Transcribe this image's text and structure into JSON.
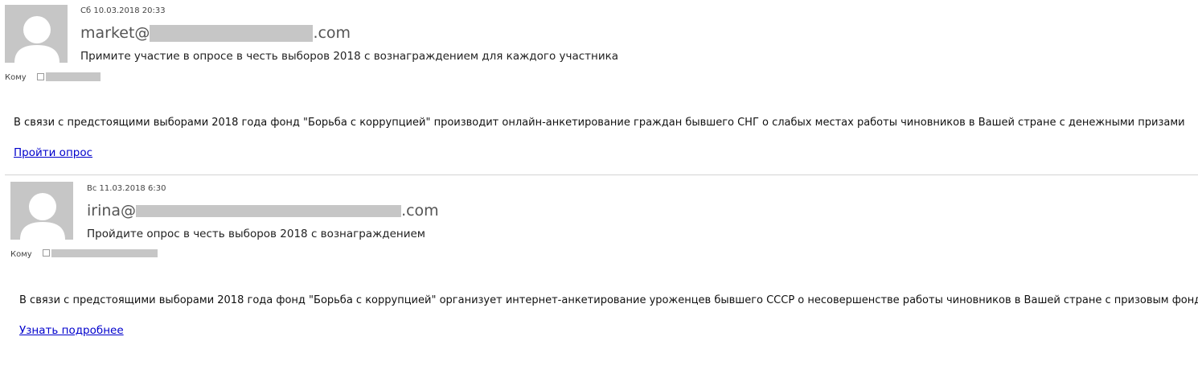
{
  "messages": [
    {
      "date": "Сб 10.03.2018 20:33",
      "sender_prefix": "market@",
      "sender_suffix": ".com",
      "subject": "Примите участие в опросе в честь выборов 2018 с вознаграждением для каждого участника",
      "to_label": "Кому",
      "body": "В связи с предстоящими выборами 2018 года фонд \"Борьба с коррупцией\" производит онлайн-анкетирование граждан бывшего СНГ о слабых местах работы чиновников в Вашей стране с денежными призами",
      "link_text": "Пройти опрос",
      "avatar_icon": "person-placeholder-icon"
    },
    {
      "date": "Вс 11.03.2018 6:30",
      "sender_prefix": "irina@",
      "sender_suffix": ".com",
      "subject": "Пройдите опрос в честь выборов 2018 с вознаграждением",
      "to_label": "Кому",
      "body": "В связи с предстоящими выборами 2018 года фонд \"Борьба с коррупцией\" организует интернет-анкетирование уроженцев бывшего СССР о несовершенстве работы чиновников в Вашей стране с призовым фондом",
      "link_text": "Узнать подробнее",
      "avatar_icon": "person-placeholder-icon"
    }
  ],
  "colors": {
    "link": "#0000cc",
    "redaction": "#c6c6c6",
    "avatar_bg": "#c6c6c6",
    "divider": "#d4d4d4"
  }
}
